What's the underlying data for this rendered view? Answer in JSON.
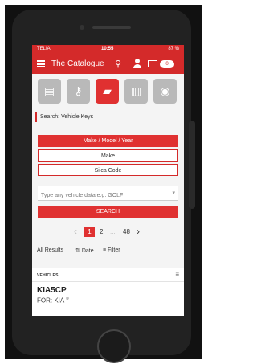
{
  "status": {
    "carrier": "TELIA",
    "time": "10:55",
    "battery": "87 %"
  },
  "app": {
    "title": "The Catalogue",
    "cart_count": "0"
  },
  "categories": [
    {
      "icon": "remote-key-icon",
      "glyph": "▤"
    },
    {
      "icon": "blank-key-icon",
      "glyph": "⚷"
    },
    {
      "icon": "car-icon",
      "glyph": "▰"
    },
    {
      "icon": "transponder-icon",
      "glyph": "▥"
    },
    {
      "icon": "key-tag-icon",
      "glyph": "◉"
    }
  ],
  "search": {
    "label": "Search: Vehicle Keys",
    "btn_make_model_year": "Make / Model / Year",
    "btn_make": "Make",
    "btn_silca_code": "Silca Code",
    "input_placeholder": "Type any vehicle data e.g. GOLF",
    "search_button": "SEARCH"
  },
  "pagination": {
    "current": "1",
    "next": "2",
    "ellipsis": "...",
    "last": "48"
  },
  "filters": {
    "all_results": "All Results",
    "date": "Date",
    "filter": "Filter"
  },
  "results": {
    "section_title": "VEHICLES",
    "items": [
      {
        "code": "KIA5CP",
        "for": "FOR: KIA"
      }
    ]
  },
  "colors": {
    "brand_red": "#d42a2a",
    "active_red": "#e03131",
    "inactive_grey": "#b9b9b9"
  }
}
